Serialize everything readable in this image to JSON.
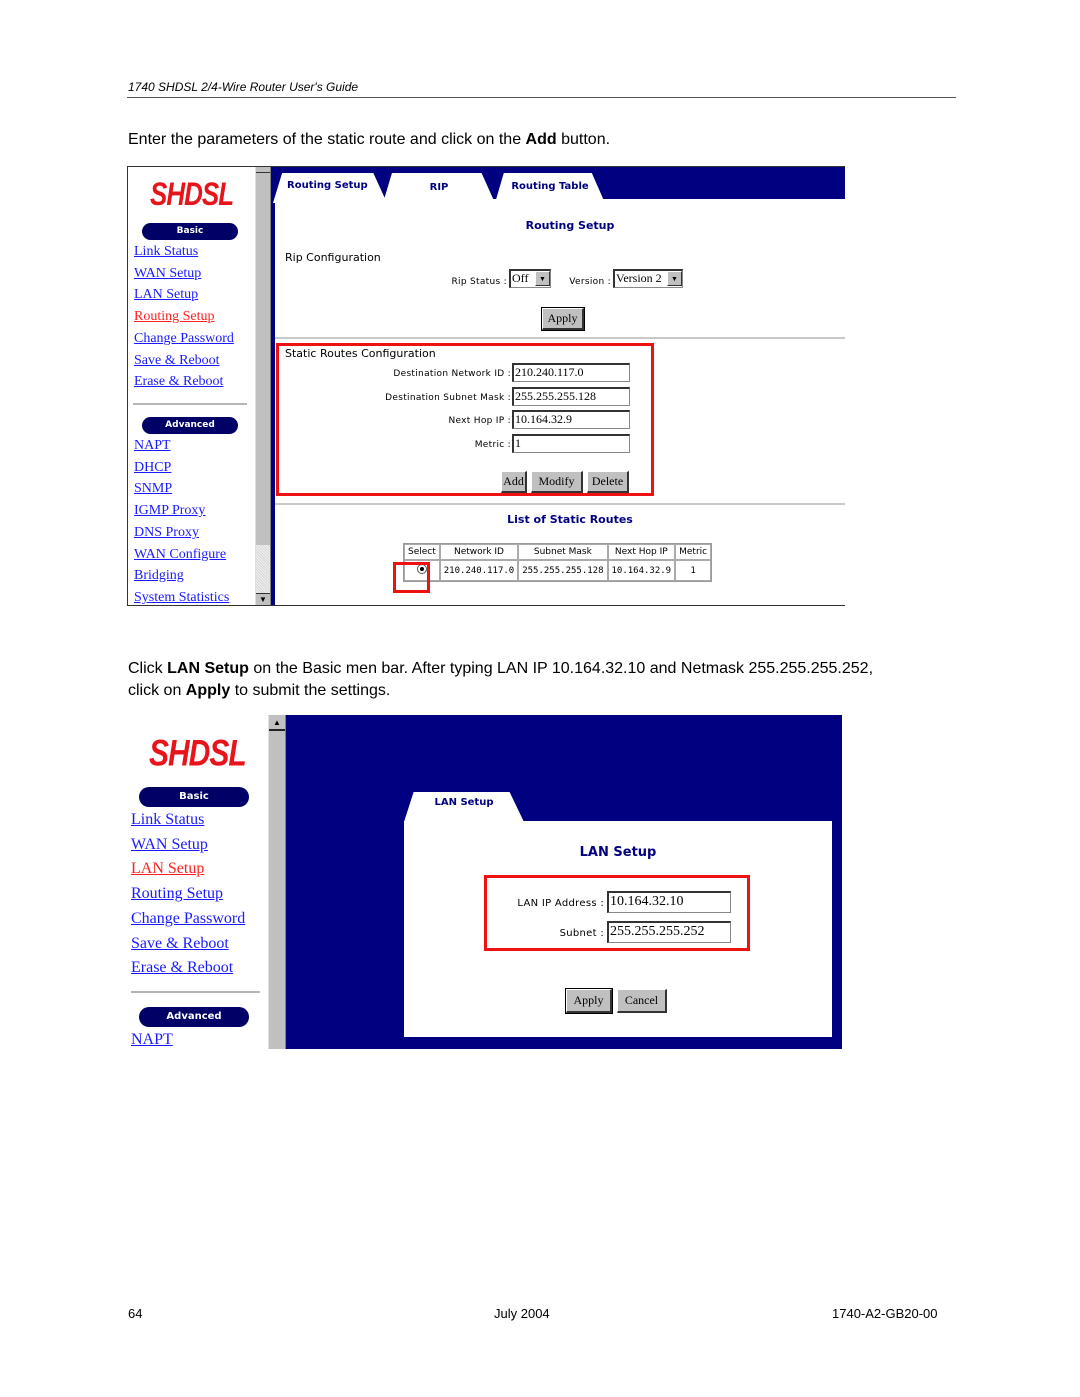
{
  "document": {
    "running_header": "1740 SHDSL 2/4-Wire Router User's Guide",
    "para1": {
      "before": "Enter the parameters of the static route and click on the ",
      "bold": "Add",
      "after": " button."
    },
    "para2_line1": {
      "t1": "Click ",
      "b1": "LAN Setup",
      "t2": " on the Basic men bar. After typing LAN IP 10.164.32.10 and Netmask 255.255.255.252,"
    },
    "para2_line2": {
      "t1": "click on ",
      "b1": "Apply",
      "t2": " to submit the settings."
    },
    "footer": {
      "page": "64",
      "date": "July 2004",
      "doc_id": "1740-A2-GB20-00"
    }
  },
  "shot1": {
    "logo": "SHDSL",
    "basic_label": "Basic",
    "advanced_label": "Advanced",
    "basic_links": [
      "Link Status",
      "WAN Setup",
      "LAN Setup",
      "Routing Setup",
      "Change Password",
      "Save & Reboot",
      "Erase & Reboot"
    ],
    "active_link": "Routing Setup",
    "advanced_links": [
      "NAPT",
      "DHCP",
      "SNMP",
      "IGMP Proxy",
      "DNS Proxy",
      "WAN Configure",
      "Bridging",
      "System Statistics"
    ],
    "tabs": [
      "Routing Setup",
      "RIP",
      "Routing Table"
    ],
    "page_title": "Routing Setup",
    "rip": {
      "section_label": "Rip Configuration",
      "status_label": "Rip Status :",
      "status_value": "Off",
      "version_label": "Version :",
      "version_value": "Version 2",
      "apply_label": "Apply"
    },
    "static": {
      "section_label": "Static Routes Configuration",
      "fields": [
        {
          "label": "Destination Network ID :",
          "value": "210.240.117.0"
        },
        {
          "label": "Destination Subnet Mask :",
          "value": "255.255.255.128"
        },
        {
          "label": "Next Hop IP :",
          "value": "10.164.32.9"
        },
        {
          "label": "Metric :",
          "value": "1"
        }
      ],
      "buttons": {
        "add": "Add",
        "modify": "Modify",
        "delete": "Delete"
      }
    },
    "list": {
      "title": "List of Static Routes",
      "columns": [
        "Select",
        "Network ID",
        "Subnet Mask",
        "Next Hop IP",
        "Metric"
      ],
      "rows": [
        {
          "selected": true,
          "network_id": "210.240.117.0",
          "subnet_mask": "255.255.255.128",
          "next_hop": "10.164.32.9",
          "metric": "1"
        }
      ]
    },
    "scroll_up_icon": "▲",
    "scroll_down_icon": "▼"
  },
  "shot2": {
    "logo": "SHDSL",
    "basic_label": "Basic",
    "advanced_label": "Advanced",
    "basic_links": [
      "Link Status",
      "WAN Setup",
      "LAN Setup",
      "Routing Setup",
      "Change Password",
      "Save & Reboot",
      "Erase & Reboot"
    ],
    "active_link": "LAN Setup",
    "advanced_links": [
      "NAPT"
    ],
    "tab": "LAN Setup",
    "page_title": "LAN Setup",
    "fields": [
      {
        "label": "LAN IP Address :",
        "value": "10.164.32.10"
      },
      {
        "label": "Subnet :",
        "value": "255.255.255.252"
      }
    ],
    "buttons": {
      "apply": "Apply",
      "cancel": "Cancel"
    },
    "scroll_up_icon": "▲"
  },
  "colors": {
    "nav_blue": "#000080",
    "link": "#1a1aff",
    "active_link": "#ff2020",
    "highlight": "#ee1111",
    "logo": "#e8141c"
  }
}
